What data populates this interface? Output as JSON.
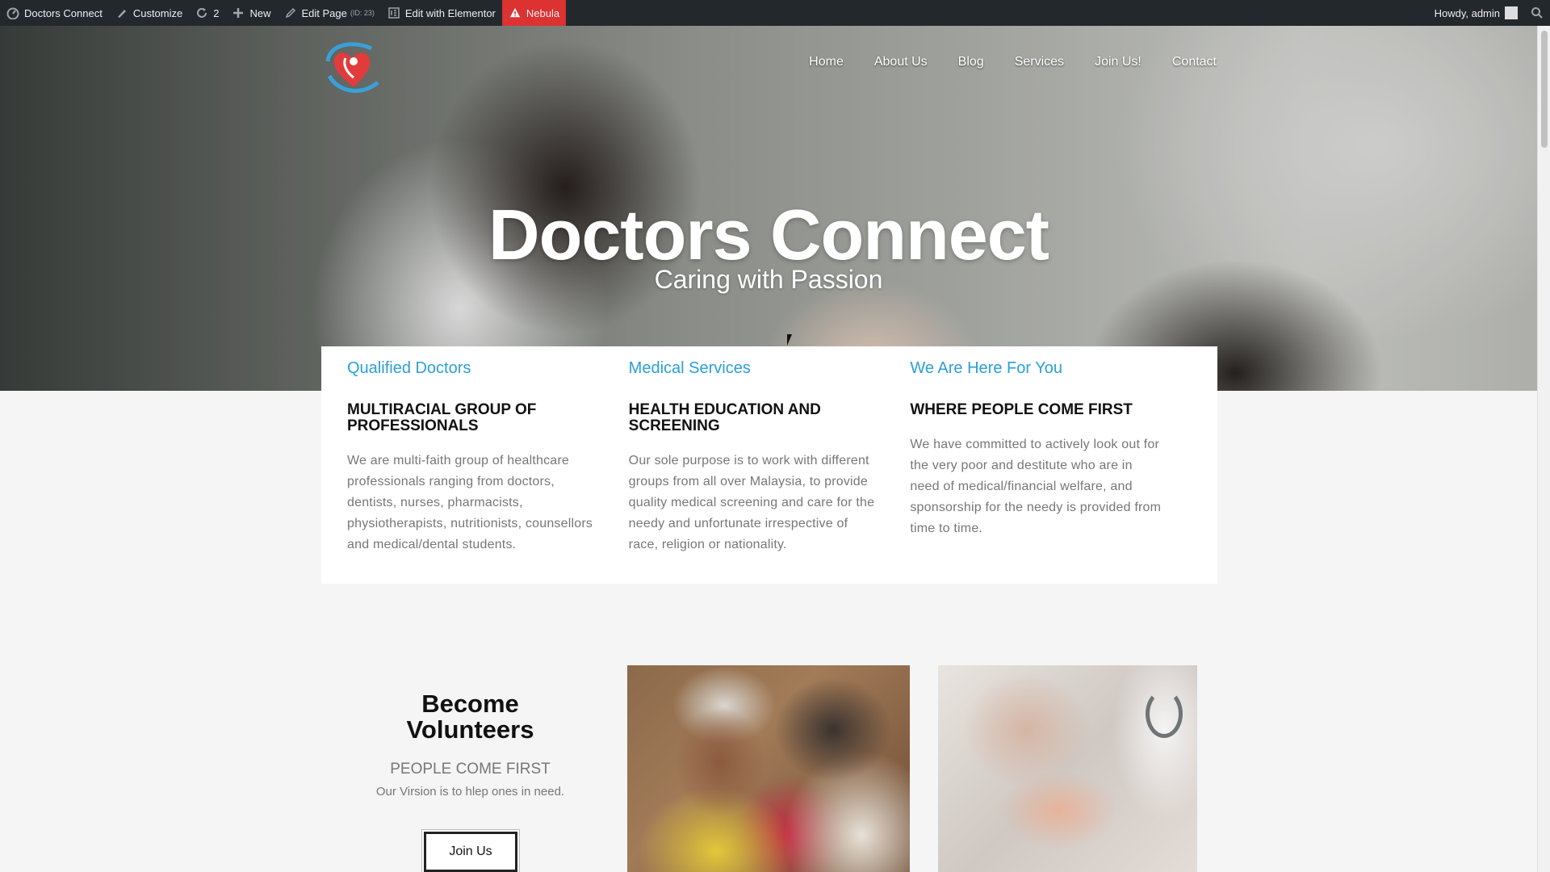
{
  "adminbar": {
    "site_name": "Doctors Connect",
    "customize": "Customize",
    "updates_count": "2",
    "new": "New",
    "edit_page": "Edit Page",
    "edit_page_id": "(ID: 23)",
    "edit_elementor": "Edit with Elementor",
    "nebula": "Nebula",
    "howdy": "Howdy, admin"
  },
  "nav": {
    "items": [
      "Home",
      "About Us",
      "Blog",
      "Services",
      "Join Us!",
      "Contact"
    ]
  },
  "hero": {
    "title": "Doctors Connect",
    "subtitle": "Caring with Passion"
  },
  "features": [
    {
      "title": "Qualified Doctors",
      "heading": "MULTIRACIAL GROUP OF PROFESSIONALS",
      "text": "We are multi-faith group of healthcare professionals ranging from doctors, dentists, nurses, pharmacists, physiotherapists, nutritionists, counsellors and medical/dental students."
    },
    {
      "title": "Medical Services",
      "heading": "HEALTH EDUCATION AND SCREENING",
      "text": "Our sole purpose is to work with different groups from all over Malaysia, to provide quality medical screening and care for the needy and unfortunate irrespective of race, religion or nationality."
    },
    {
      "title": "We Are Here For You",
      "heading": "WHERE PEOPLE COME FIRST",
      "text": "We have committed to actively look out for the very poor and destitute who are in need of medical/financial welfare, and sponsorship for the needy is provided from time to time."
    }
  ],
  "volunteer": {
    "title": "Become Volunteers",
    "tagline": "PEOPLE COME FIRST",
    "line": "Our Virsion is to hlep ones in need.",
    "button": "Join Us"
  },
  "colors": {
    "accent": "#2b9fd6",
    "adminbar": "#23282d",
    "nebula": "#dc3232"
  }
}
